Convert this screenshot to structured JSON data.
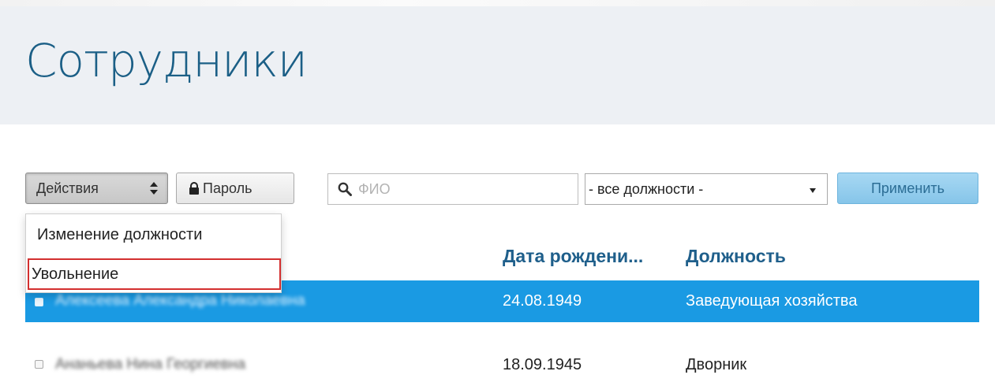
{
  "page": {
    "title": "Сотрудники"
  },
  "toolbar": {
    "actions_label": "Действия",
    "password_label": "Пароль",
    "search_placeholder": "ФИО",
    "position_select_value": "- все должности -",
    "apply_label": "Применить"
  },
  "actions_menu": {
    "items": [
      "Изменение должности",
      "Увольнение"
    ],
    "highlighted": "Увольнение"
  },
  "table": {
    "columns": {
      "date": "Дата рождени...",
      "position": "Должность"
    },
    "rows": [
      {
        "name": "Алексеева Александра Николаевна",
        "date": "24.08.1949",
        "position": "Заведующая хозяйства",
        "selected": true
      },
      {
        "name": "Ананьева Нина Георгиевна",
        "date": "18.09.1945",
        "position": "Дворник",
        "selected": false
      }
    ]
  },
  "colors": {
    "title": "#1b5f86",
    "header_bg": "#edf0f4",
    "selected_row": "#1a9ae3",
    "apply_button": "#96cfee",
    "highlight_border": "#d32f2f"
  },
  "icons": [
    "updown-icon",
    "lock-icon",
    "search-icon",
    "caret-down-icon"
  ]
}
